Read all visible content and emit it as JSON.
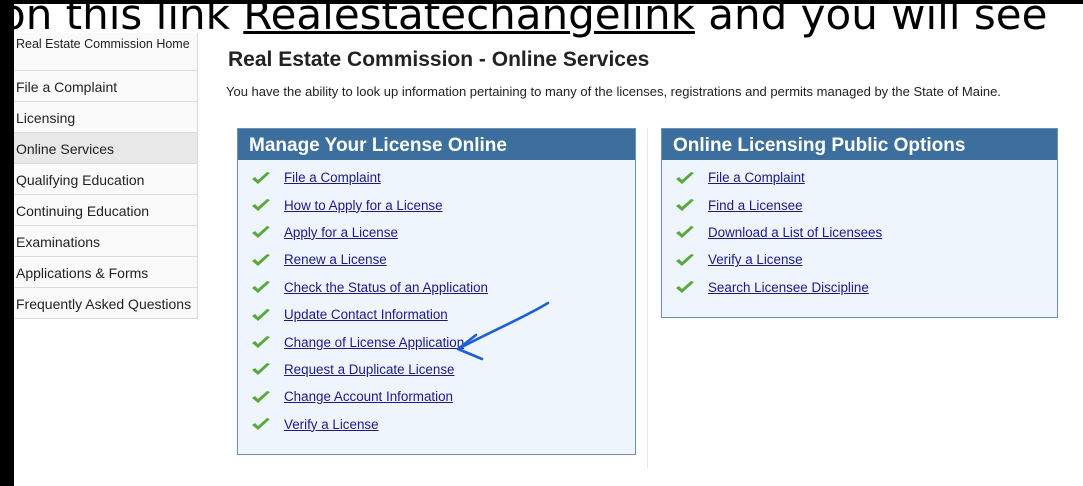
{
  "caption": {
    "prefix": "on this link ",
    "link": "Realestatechangelink",
    "suffix": " and you will see"
  },
  "sidebar": {
    "items": [
      {
        "label": "Real Estate Commission Home"
      },
      {
        "label": "File a Complaint"
      },
      {
        "label": "Licensing"
      },
      {
        "label": "Online Services",
        "active": true
      },
      {
        "label": "Qualifying Education"
      },
      {
        "label": "Continuing Education"
      },
      {
        "label": "Examinations"
      },
      {
        "label": "Applications & Forms"
      },
      {
        "label": "Frequently Asked Questions"
      }
    ]
  },
  "main": {
    "title": "Real Estate Commission - Online Services",
    "intro": "You have the ability to look up information pertaining to many of the licenses, registrations and permits managed by the State of Maine."
  },
  "manage_panel": {
    "heading": "Manage Your License Online",
    "links": [
      "File a Complaint",
      "How to Apply for a License",
      "Apply for a License",
      "Renew a License",
      "Check the Status of an Application",
      "Update Contact Information",
      "Change of License Application",
      "Request a Duplicate License",
      "Change Account Information",
      "Verify a License"
    ]
  },
  "public_panel": {
    "heading": "Online Licensing Public Options",
    "links": [
      "File a Complaint",
      "Find a Licensee",
      "Download a List of Licensees",
      "Verify a License",
      "Search Licensee Discipline"
    ]
  },
  "colors": {
    "panel_header": "#3d6f9e",
    "panel_bg": "#eef5fc",
    "link": "#1a1a8c",
    "check": "#5aa83c",
    "annotation_arrow": "#1f5fd6"
  },
  "icons": {
    "link_bullet": "check-icon",
    "annotation": "arrow-icon"
  }
}
